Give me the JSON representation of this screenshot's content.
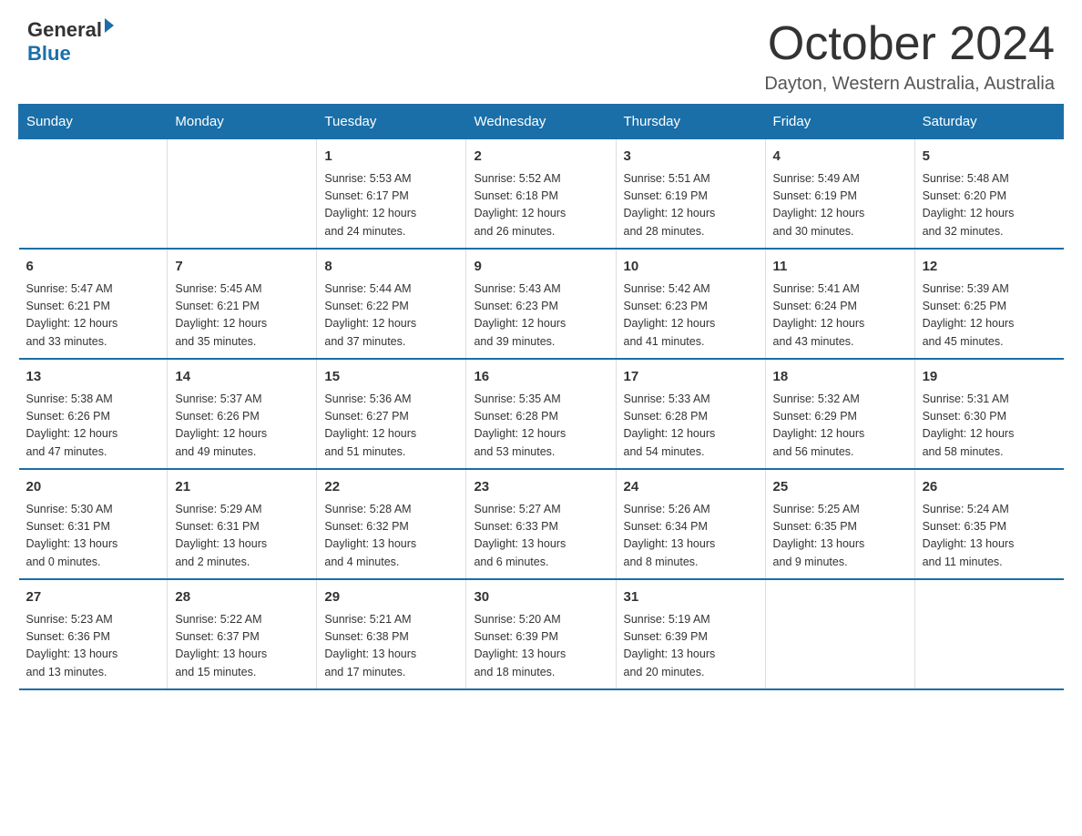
{
  "header": {
    "logo_general": "General",
    "logo_blue": "Blue",
    "month_title": "October 2024",
    "location": "Dayton, Western Australia, Australia"
  },
  "weekdays": [
    "Sunday",
    "Monday",
    "Tuesday",
    "Wednesday",
    "Thursday",
    "Friday",
    "Saturday"
  ],
  "weeks": [
    [
      {
        "day": "",
        "info": ""
      },
      {
        "day": "",
        "info": ""
      },
      {
        "day": "1",
        "info": "Sunrise: 5:53 AM\nSunset: 6:17 PM\nDaylight: 12 hours\nand 24 minutes."
      },
      {
        "day": "2",
        "info": "Sunrise: 5:52 AM\nSunset: 6:18 PM\nDaylight: 12 hours\nand 26 minutes."
      },
      {
        "day": "3",
        "info": "Sunrise: 5:51 AM\nSunset: 6:19 PM\nDaylight: 12 hours\nand 28 minutes."
      },
      {
        "day": "4",
        "info": "Sunrise: 5:49 AM\nSunset: 6:19 PM\nDaylight: 12 hours\nand 30 minutes."
      },
      {
        "day": "5",
        "info": "Sunrise: 5:48 AM\nSunset: 6:20 PM\nDaylight: 12 hours\nand 32 minutes."
      }
    ],
    [
      {
        "day": "6",
        "info": "Sunrise: 5:47 AM\nSunset: 6:21 PM\nDaylight: 12 hours\nand 33 minutes."
      },
      {
        "day": "7",
        "info": "Sunrise: 5:45 AM\nSunset: 6:21 PM\nDaylight: 12 hours\nand 35 minutes."
      },
      {
        "day": "8",
        "info": "Sunrise: 5:44 AM\nSunset: 6:22 PM\nDaylight: 12 hours\nand 37 minutes."
      },
      {
        "day": "9",
        "info": "Sunrise: 5:43 AM\nSunset: 6:23 PM\nDaylight: 12 hours\nand 39 minutes."
      },
      {
        "day": "10",
        "info": "Sunrise: 5:42 AM\nSunset: 6:23 PM\nDaylight: 12 hours\nand 41 minutes."
      },
      {
        "day": "11",
        "info": "Sunrise: 5:41 AM\nSunset: 6:24 PM\nDaylight: 12 hours\nand 43 minutes."
      },
      {
        "day": "12",
        "info": "Sunrise: 5:39 AM\nSunset: 6:25 PM\nDaylight: 12 hours\nand 45 minutes."
      }
    ],
    [
      {
        "day": "13",
        "info": "Sunrise: 5:38 AM\nSunset: 6:26 PM\nDaylight: 12 hours\nand 47 minutes."
      },
      {
        "day": "14",
        "info": "Sunrise: 5:37 AM\nSunset: 6:26 PM\nDaylight: 12 hours\nand 49 minutes."
      },
      {
        "day": "15",
        "info": "Sunrise: 5:36 AM\nSunset: 6:27 PM\nDaylight: 12 hours\nand 51 minutes."
      },
      {
        "day": "16",
        "info": "Sunrise: 5:35 AM\nSunset: 6:28 PM\nDaylight: 12 hours\nand 53 minutes."
      },
      {
        "day": "17",
        "info": "Sunrise: 5:33 AM\nSunset: 6:28 PM\nDaylight: 12 hours\nand 54 minutes."
      },
      {
        "day": "18",
        "info": "Sunrise: 5:32 AM\nSunset: 6:29 PM\nDaylight: 12 hours\nand 56 minutes."
      },
      {
        "day": "19",
        "info": "Sunrise: 5:31 AM\nSunset: 6:30 PM\nDaylight: 12 hours\nand 58 minutes."
      }
    ],
    [
      {
        "day": "20",
        "info": "Sunrise: 5:30 AM\nSunset: 6:31 PM\nDaylight: 13 hours\nand 0 minutes."
      },
      {
        "day": "21",
        "info": "Sunrise: 5:29 AM\nSunset: 6:31 PM\nDaylight: 13 hours\nand 2 minutes."
      },
      {
        "day": "22",
        "info": "Sunrise: 5:28 AM\nSunset: 6:32 PM\nDaylight: 13 hours\nand 4 minutes."
      },
      {
        "day": "23",
        "info": "Sunrise: 5:27 AM\nSunset: 6:33 PM\nDaylight: 13 hours\nand 6 minutes."
      },
      {
        "day": "24",
        "info": "Sunrise: 5:26 AM\nSunset: 6:34 PM\nDaylight: 13 hours\nand 8 minutes."
      },
      {
        "day": "25",
        "info": "Sunrise: 5:25 AM\nSunset: 6:35 PM\nDaylight: 13 hours\nand 9 minutes."
      },
      {
        "day": "26",
        "info": "Sunrise: 5:24 AM\nSunset: 6:35 PM\nDaylight: 13 hours\nand 11 minutes."
      }
    ],
    [
      {
        "day": "27",
        "info": "Sunrise: 5:23 AM\nSunset: 6:36 PM\nDaylight: 13 hours\nand 13 minutes."
      },
      {
        "day": "28",
        "info": "Sunrise: 5:22 AM\nSunset: 6:37 PM\nDaylight: 13 hours\nand 15 minutes."
      },
      {
        "day": "29",
        "info": "Sunrise: 5:21 AM\nSunset: 6:38 PM\nDaylight: 13 hours\nand 17 minutes."
      },
      {
        "day": "30",
        "info": "Sunrise: 5:20 AM\nSunset: 6:39 PM\nDaylight: 13 hours\nand 18 minutes."
      },
      {
        "day": "31",
        "info": "Sunrise: 5:19 AM\nSunset: 6:39 PM\nDaylight: 13 hours\nand 20 minutes."
      },
      {
        "day": "",
        "info": ""
      },
      {
        "day": "",
        "info": ""
      }
    ]
  ]
}
